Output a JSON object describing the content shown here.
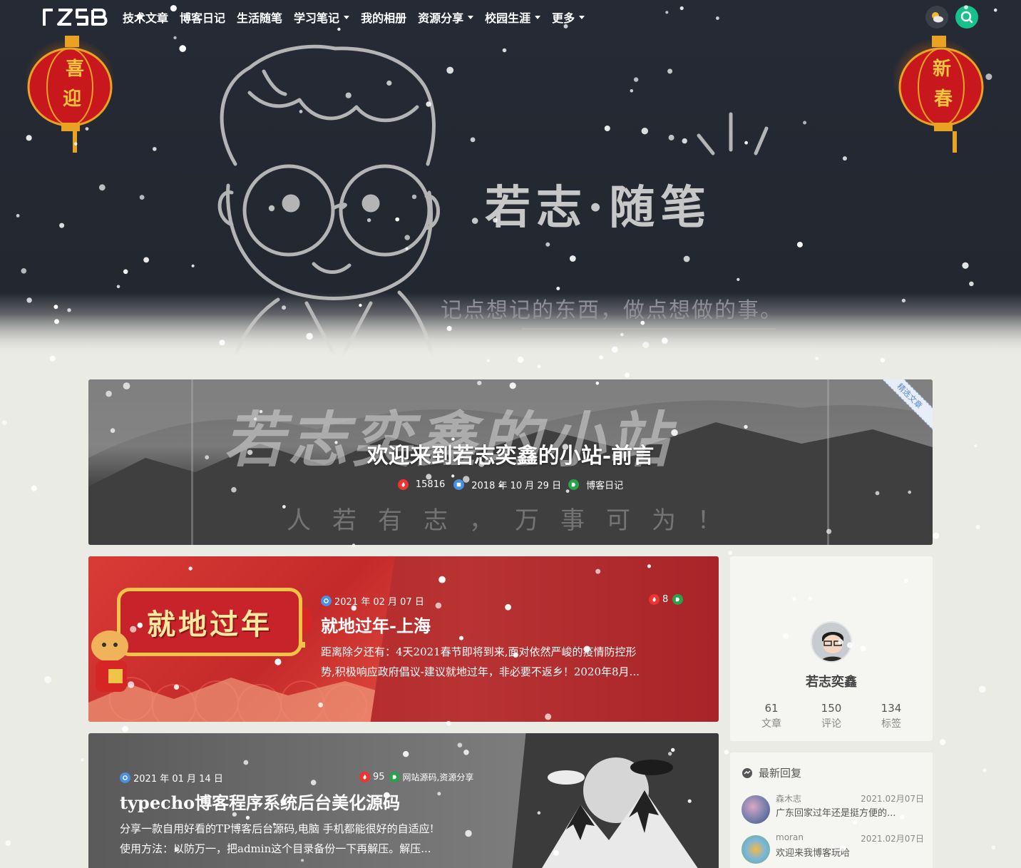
{
  "nav": {
    "logo_text": "RZSB",
    "items": [
      {
        "label": "技术文章",
        "dropdown": false
      },
      {
        "label": "博客日记",
        "dropdown": false
      },
      {
        "label": "生活随笔",
        "dropdown": false
      },
      {
        "label": "学习笔记",
        "dropdown": true
      },
      {
        "label": "我的相册",
        "dropdown": false
      },
      {
        "label": "资源分享",
        "dropdown": true
      },
      {
        "label": "校园生涯",
        "dropdown": true
      },
      {
        "label": "更多",
        "dropdown": true
      }
    ],
    "theme_icon": "weather-theme-icon",
    "search_icon": "search-icon"
  },
  "hero": {
    "title": "若志·随笔",
    "subtitle": "记点想记的东西，做点想做的事。",
    "lantern_left": [
      "喜",
      "迎"
    ],
    "lantern_right": [
      "新",
      "春"
    ]
  },
  "featured": {
    "bg_text": "若志奕鑫的小站",
    "motto": "人若有志，万事可为！",
    "title": "欢迎来到若志奕鑫的小站-前言",
    "views": "15816",
    "date": "2018 年 10 月 29 日",
    "category": "博客日记",
    "ribbon": "精选文章"
  },
  "posts": [
    {
      "date": "2021 年 02 月 07 日",
      "views": "8",
      "tags": "",
      "title": "就地过年-上海",
      "excerpt_line1": "距离除夕还有：4天2021春节即将到来,面对依然严峻的疫情防控形",
      "excerpt_line2": "势,积极响应政府倡议-建议就地过年，非必要不返乡！2020年8月...",
      "image_text": "就地过年"
    },
    {
      "date": "2021 年 01 月 14 日",
      "views": "95",
      "tags": "网站源码,资源分享",
      "title": "typecho博客程序系统后台美化源码",
      "excerpt_line1": "分享一款自用好看的TP博客后台源码,电脑 手机都能很好的自适应!",
      "excerpt_line2": "使用方法：以防万一，把admin这个目录备份一下再解压。解压..."
    }
  ],
  "profile": {
    "name": "若志奕鑫",
    "stats": [
      {
        "num": "61",
        "label": "文章"
      },
      {
        "num": "150",
        "label": "评论"
      },
      {
        "num": "134",
        "label": "标签"
      }
    ]
  },
  "replies": {
    "heading": "最新回复",
    "items": [
      {
        "name": "森木志",
        "date": "2021.02月07日",
        "text": "广东回家过年还是挺方便的..."
      },
      {
        "name": "moran",
        "date": "2021.02月07日",
        "text": "欢迎来我博客玩哈"
      }
    ]
  },
  "colors": {
    "accent_green": "#18c08b",
    "lantern_red": "#c9181d",
    "card_red": "#b32a2a"
  }
}
